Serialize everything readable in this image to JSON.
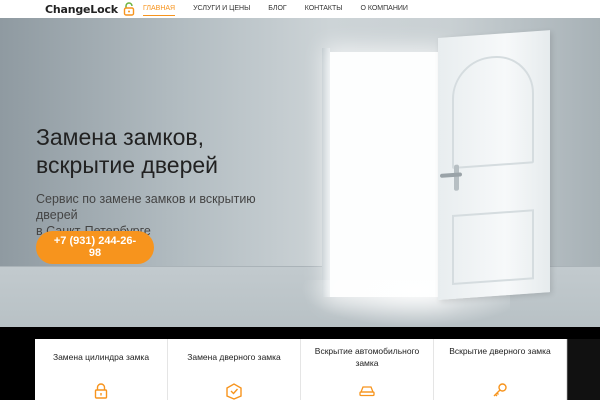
{
  "header": {
    "logo_text": "ChangeLock",
    "logo_icon": "padlock-icon",
    "nav": [
      {
        "label": "ГЛАВНАЯ",
        "active": true
      },
      {
        "label": "УСЛУГИ И ЦЕНЫ",
        "active": false
      },
      {
        "label": "БЛОГ",
        "active": false
      },
      {
        "label": "КОНТАКТЫ",
        "active": false
      },
      {
        "label": "О КОМПАНИИ",
        "active": false
      }
    ]
  },
  "hero": {
    "title_line1": "Замена замков,",
    "title_line2": "вскрытие дверей",
    "subtitle_line1": "Сервис по замене замков и вскрытию дверей",
    "subtitle_line2": "в Санкт-Петербурге",
    "phone_line1": "+7 (931) 244-26-",
    "phone_line2": "98"
  },
  "services": [
    {
      "title": "Замена цилиндра замка",
      "icon": "lock-icon"
    },
    {
      "title": "Замена дверного замка",
      "icon": "door-lock-box-icon"
    },
    {
      "title": "Вскрытие автомобильного замка",
      "icon": "car-icon"
    },
    {
      "title": "Вскрытие дверного замка",
      "icon": "key-icon"
    }
  ],
  "colors": {
    "accent": "#f7941d",
    "logo_green": "#6db33f"
  }
}
